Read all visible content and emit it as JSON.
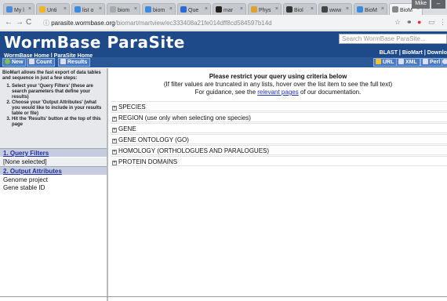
{
  "browser": {
    "tabs": [
      {
        "label": "My l",
        "color": "#4d8bd6"
      },
      {
        "label": "Unti",
        "color": "#f0b429"
      },
      {
        "label": "list o",
        "color": "#3c8be0"
      },
      {
        "label": "biom",
        "color": "#888888"
      },
      {
        "label": "biom",
        "color": "#3c8be0"
      },
      {
        "label": "Que",
        "color": "#2c6bd1"
      },
      {
        "label": "mar",
        "color": "#222222"
      },
      {
        "label": "Phys",
        "color": "#e0a030"
      },
      {
        "label": "Biol",
        "color": "#333333"
      },
      {
        "label": "www",
        "color": "#444444"
      },
      {
        "label": "BioM",
        "color": "#3c8be0"
      },
      {
        "label": "BioM",
        "color": "#888888"
      }
    ],
    "user": "Mike",
    "url_host": "parasite.wormbase.org",
    "url_path": "/biomart/martview/ec333408a21fe014dff8cd584597b14d"
  },
  "header": {
    "logo": "WormBase ParaSite",
    "home_links": "WormBase Home | ParaSite Home",
    "search_placeholder": "Search WormBase ParaSite...",
    "right_links": "BLAST  |  BioMart  |  Downlo"
  },
  "toolbar": {
    "new_label": "New",
    "count_label": "Count",
    "results_label": "Results",
    "url_label": "URL",
    "xml_label": "XML",
    "perl_label": "Perl"
  },
  "sidebar": {
    "intro": "BioMart allows the fast export of data tables and sequence in just a few steps:",
    "steps": [
      "Select your 'Query Filters' (these are search parameters that define your results)",
      "Choose your 'Output Attributes' (what you would like to include in your results table or file)",
      "Hit the 'Results' button at the top of this page"
    ],
    "query_filters_title": "1. Query Filters",
    "query_filters_value": "[None selected]",
    "output_attributes_title": "2. Output Attributes",
    "attributes": [
      "Genome project",
      "Gene stable ID"
    ]
  },
  "main": {
    "notice_title": "Please restrict your query using criteria below",
    "notice_line2": "(If filter values are truncated in any lists, hover over the list item to see the full text)",
    "notice_line3_pre": "For guidance, see the ",
    "notice_link": "relevant pages",
    "notice_line3_post": " of our documentation.",
    "filters": [
      "SPECIES",
      "REGION (use only when selecting one species)",
      "GENE",
      "GENE ONTOLOGY (GO)",
      "HOMOLOGY (ORTHOLOGUES AND PARALOGUES)",
      "PROTEIN DOMAINS"
    ]
  }
}
